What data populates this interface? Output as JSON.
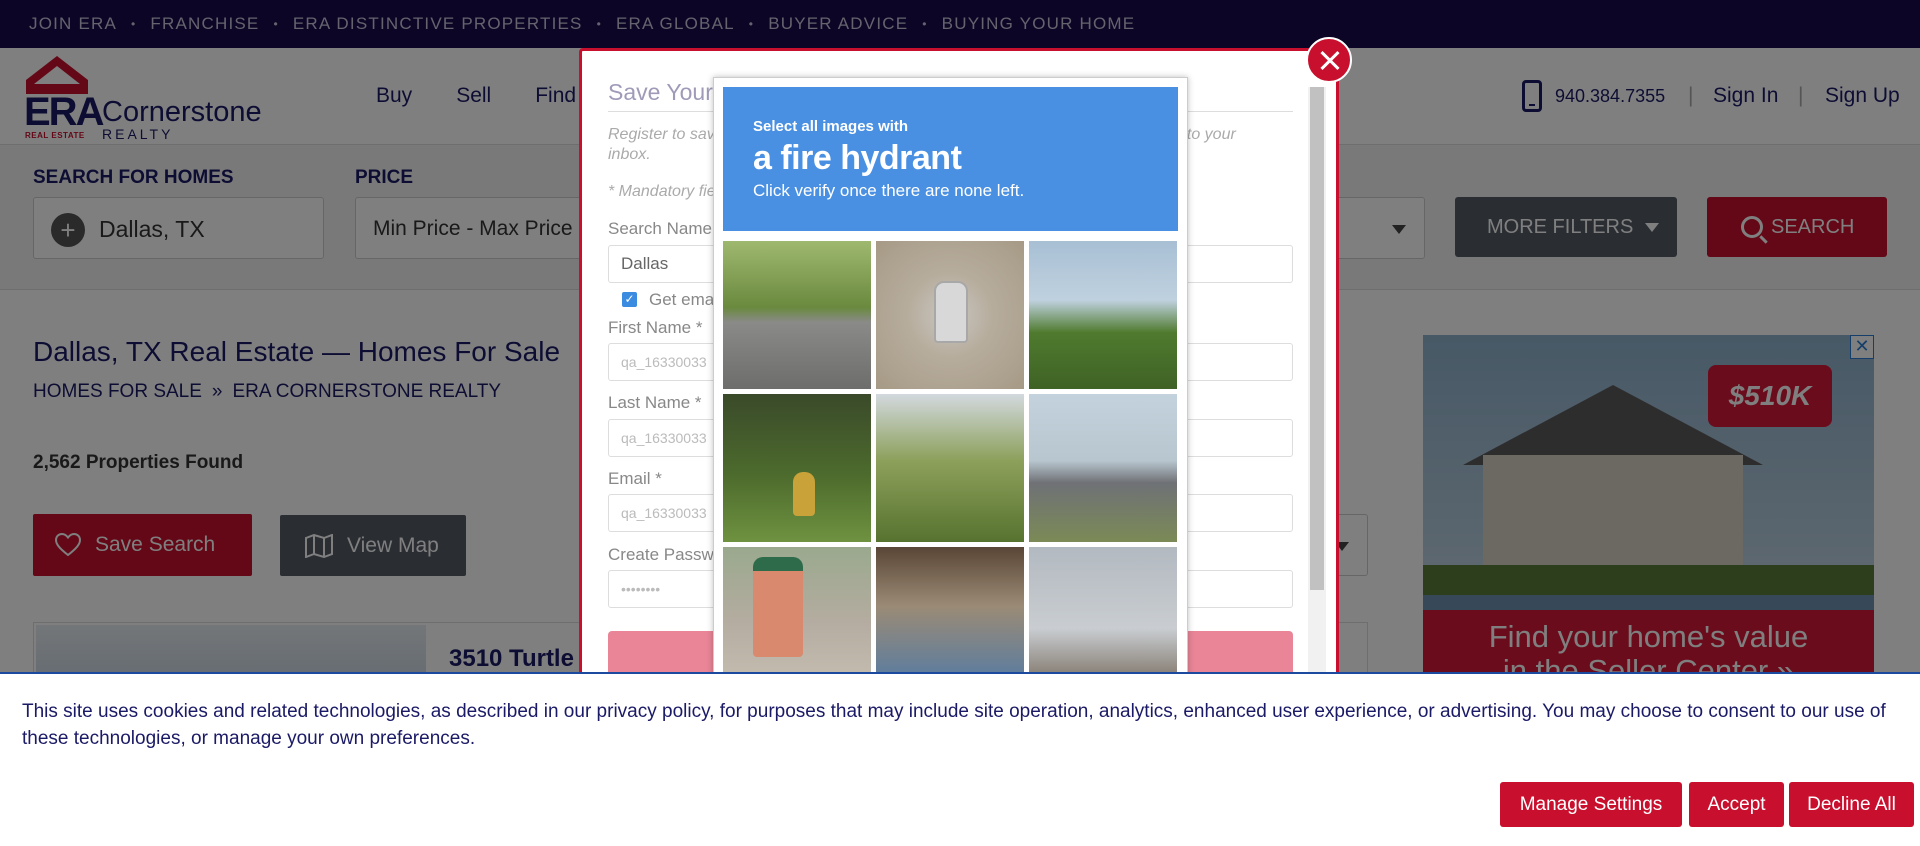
{
  "topnav": {
    "items": [
      "JOIN ERA",
      "FRANCHISE",
      "ERA DISTINCTIVE PROPERTIES",
      "ERA GLOBAL",
      "BUYER ADVICE",
      "BUYING YOUR HOME"
    ]
  },
  "brand": {
    "era": "ERA",
    "era_sub": "REAL ESTATE",
    "name": "Cornerstone",
    "sub": "REALTY"
  },
  "mainnav": [
    "Buy",
    "Sell",
    "Find"
  ],
  "header": {
    "phone": "940.384.7355",
    "signin": "Sign In",
    "signup": "Sign Up",
    "separator": "|"
  },
  "search": {
    "location_label": "SEARCH FOR HOMES",
    "location_value": "Dallas, TX",
    "price_label": "PRICE",
    "price_value": "Min Price  -  Max Price",
    "more_filters": "MORE FILTERS",
    "search_button": "SEARCH"
  },
  "results": {
    "title": "Dallas, TX Real Estate — Homes For Sale",
    "breadcrumb": [
      "HOMES FOR SALE",
      "»",
      "ERA CORNERSTONE REALTY"
    ],
    "count": "2,562 Properties Found",
    "save_search": "Save Search",
    "view_map": "View Map",
    "first_listing_address": "3510 Turtle"
  },
  "ad": {
    "price": "$510K",
    "tagline": "Find your home's value",
    "tagline2": "in the Seller Center »",
    "close": "✕"
  },
  "modal": {
    "title": "Save Your Search",
    "description_left": "Register to save",
    "description_right": "t to your",
    "description_line2": "inbox.",
    "mandatory": "* Mandatory fields",
    "search_name_label": "Search Name",
    "search_name_value": "Dallas",
    "email_checkbox_label": "Get emails",
    "first_name_label": "First Name *",
    "first_name_value": "qa_16330033",
    "last_name_label": "Last Name *",
    "last_name_value": "qa_16330033",
    "email_label": "Email *",
    "email_value": "qa_16330033",
    "password_label": "Create Password",
    "password_value": "••••••••"
  },
  "captcha": {
    "line1": "Select all images with",
    "line2": "a fire hydrant",
    "line3": "Click verify once there are none left."
  },
  "cookie": {
    "text": "This site uses cookies and related technologies, as described in our privacy policy, for purposes that may include site operation, analytics, enhanced user experience, or advertising. You may choose to consent to our use of these technologies, or manage your own preferences.",
    "manage": "Manage Settings",
    "accept": "Accept",
    "decline": "Decline All"
  },
  "colors": {
    "brand_red": "#c8102e",
    "brand_navy": "#1b0a4a",
    "captcha_blue": "#4a90e2"
  }
}
